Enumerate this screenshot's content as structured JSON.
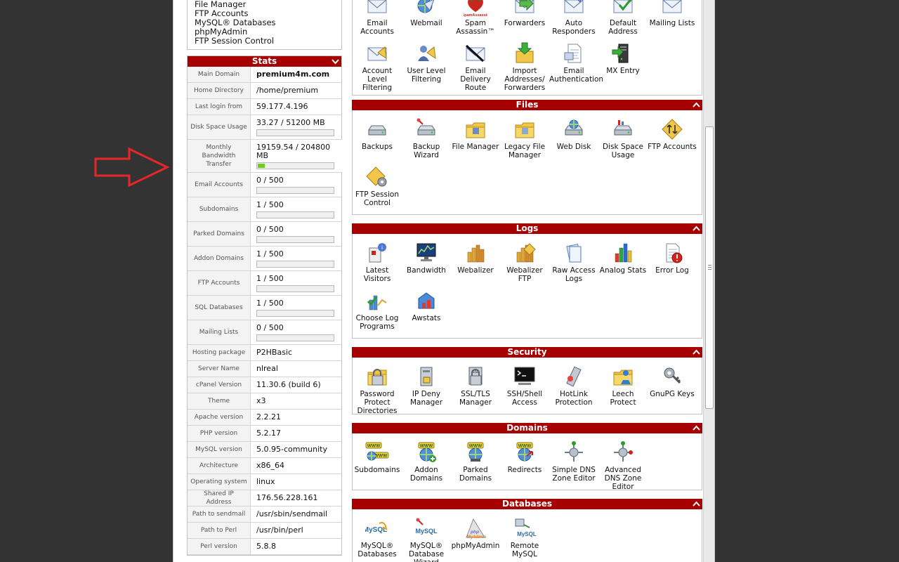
{
  "quick_links": [
    "File Manager",
    "FTP Accounts",
    "MySQL® Databases",
    "phpMyAdmin",
    "FTP Session Control"
  ],
  "stats": {
    "title": "Stats",
    "rows": [
      {
        "label": "Main Domain",
        "value": "premium4m.com",
        "bold": true
      },
      {
        "label": "Home Directory",
        "value": "/home/premium"
      },
      {
        "label": "Last login from",
        "value": "59.177.4.196"
      },
      {
        "label": "Disk Space Usage",
        "value": "33.27 / 51200 MB",
        "bar": 0.0
      },
      {
        "label": "Monthly Bandwidth Transfer",
        "value": "19159.54 / 204800 MB",
        "bar": 0.09
      },
      {
        "label": "Email Accounts",
        "value": "0 / 500",
        "bar": 0.0
      },
      {
        "label": "Subdomains",
        "value": "1 / 500",
        "bar": 0.0
      },
      {
        "label": "Parked Domains",
        "value": "0 / 500",
        "bar": 0.0
      },
      {
        "label": "Addon Domains",
        "value": "1 / 500",
        "bar": 0.0
      },
      {
        "label": "FTP Accounts",
        "value": "1 / 500",
        "bar": 0.0
      },
      {
        "label": "SQL Databases",
        "value": "1 / 500",
        "bar": 0.0
      },
      {
        "label": "Mailing Lists",
        "value": "0 / 500",
        "bar": 0.0
      },
      {
        "label": "Hosting package",
        "value": "P2HBasic"
      },
      {
        "label": "Server Name",
        "value": "nlreal"
      },
      {
        "label": "cPanel Version",
        "value": "11.30.6 (build 6)"
      },
      {
        "label": "Theme",
        "value": "x3"
      },
      {
        "label": "Apache version",
        "value": "2.2.21"
      },
      {
        "label": "PHP version",
        "value": "5.2.17"
      },
      {
        "label": "MySQL version",
        "value": "5.0.95-community"
      },
      {
        "label": "Architecture",
        "value": "x86_64"
      },
      {
        "label": "Operating system",
        "value": "linux"
      },
      {
        "label": "Shared IP Address",
        "value": "176.56.228.161"
      },
      {
        "label": "Path to sendmail",
        "value": "/usr/sbin/sendmail"
      },
      {
        "label": "Path to Perl",
        "value": "/usr/bin/perl"
      },
      {
        "label": "Perl version",
        "value": "5.8.8"
      }
    ]
  },
  "mail_items": [
    {
      "label": "Email Accounts",
      "icon": "email-accounts-icon"
    },
    {
      "label": "Webmail",
      "icon": "webmail-icon"
    },
    {
      "label": "Spam Assassin™",
      "icon": "spamassassin-icon"
    },
    {
      "label": "Forwarders",
      "icon": "forwarders-icon"
    },
    {
      "label": "Auto Responders",
      "icon": "auto-responders-icon"
    },
    {
      "label": "Default Address",
      "icon": "default-address-icon"
    },
    {
      "label": "Mailing Lists",
      "icon": "mailing-lists-icon"
    },
    {
      "label": "Account Level Filtering",
      "icon": "account-filtering-icon"
    },
    {
      "label": "User Level Filtering",
      "icon": "user-filtering-icon"
    },
    {
      "label": "Email Delivery Route",
      "icon": "email-delivery-route-icon"
    },
    {
      "label": "Import Addresses/ Forwarders",
      "icon": "import-addresses-icon"
    },
    {
      "label": "Email Authentication",
      "icon": "email-authentication-icon"
    },
    {
      "label": "MX Entry",
      "icon": "mx-entry-icon"
    }
  ],
  "spam_logo_text": "SpamAssassin",
  "sections": [
    {
      "title": "Files",
      "items": [
        {
          "label": "Backups",
          "icon": "backups-icon"
        },
        {
          "label": "Backup Wizard",
          "icon": "backup-wizard-icon"
        },
        {
          "label": "File Manager",
          "icon": "file-manager-icon"
        },
        {
          "label": "Legacy File Manager",
          "icon": "legacy-file-manager-icon"
        },
        {
          "label": "Web Disk",
          "icon": "web-disk-icon"
        },
        {
          "label": "Disk Space Usage",
          "icon": "disk-space-usage-icon"
        },
        {
          "label": "FTP Accounts",
          "icon": "ftp-accounts-icon"
        },
        {
          "label": "FTP Session Control",
          "icon": "ftp-session-control-icon"
        }
      ]
    },
    {
      "title": "Logs",
      "items": [
        {
          "label": "Latest Visitors",
          "icon": "latest-visitors-icon"
        },
        {
          "label": "Bandwidth",
          "icon": "bandwidth-icon"
        },
        {
          "label": "Webalizer",
          "icon": "webalizer-icon"
        },
        {
          "label": "Webalizer FTP",
          "icon": "webalizer-ftp-icon"
        },
        {
          "label": "Raw Access Logs",
          "icon": "raw-access-logs-icon"
        },
        {
          "label": "Analog Stats",
          "icon": "analog-stats-icon"
        },
        {
          "label": "Error Log",
          "icon": "error-log-icon"
        },
        {
          "label": "Choose Log Programs",
          "icon": "choose-log-programs-icon"
        },
        {
          "label": "Awstats",
          "icon": "awstats-icon"
        }
      ]
    },
    {
      "title": "Security",
      "items": [
        {
          "label": "Password Protect Directories",
          "icon": "password-protect-icon"
        },
        {
          "label": "IP Deny Manager",
          "icon": "ip-deny-manager-icon"
        },
        {
          "label": "SSL/TLS Manager",
          "icon": "ssl-tls-manager-icon"
        },
        {
          "label": "SSH/Shell Access",
          "icon": "ssh-shell-access-icon"
        },
        {
          "label": "HotLink Protection",
          "icon": "hotlink-protection-icon"
        },
        {
          "label": "Leech Protect",
          "icon": "leech-protect-icon"
        },
        {
          "label": "GnuPG Keys",
          "icon": "gnupg-keys-icon"
        }
      ]
    },
    {
      "title": "Domains",
      "items": [
        {
          "label": "Subdomains",
          "icon": "subdomains-icon"
        },
        {
          "label": "Addon Domains",
          "icon": "addon-domains-icon"
        },
        {
          "label": "Parked Domains",
          "icon": "parked-domains-icon"
        },
        {
          "label": "Redirects",
          "icon": "redirects-icon"
        },
        {
          "label": "Simple DNS Zone Editor",
          "icon": "simple-dns-zone-editor-icon"
        },
        {
          "label": "Advanced DNS Zone Editor",
          "icon": "advanced-dns-zone-editor-icon"
        }
      ]
    },
    {
      "title": "Databases",
      "items": [
        {
          "label": "MySQL® Databases",
          "icon": "mysql-databases-icon"
        },
        {
          "label": "MySQL® Database Wizard",
          "icon": "mysql-database-wizard-icon"
        },
        {
          "label": "phpMyAdmin",
          "icon": "phpmyadmin-icon"
        },
        {
          "label": "Remote MySQL",
          "icon": "remote-mysql-icon"
        }
      ]
    }
  ],
  "www_text": "WWW",
  "mysql_logo_text": "MySQL",
  "php_logo_text": "php",
  "phpmyadmin_logo_text": "MyAdmin",
  "colors": {
    "section_header": "#a70000",
    "bar_fill": "#6fce1a",
    "annotation": "#e8262a"
  }
}
